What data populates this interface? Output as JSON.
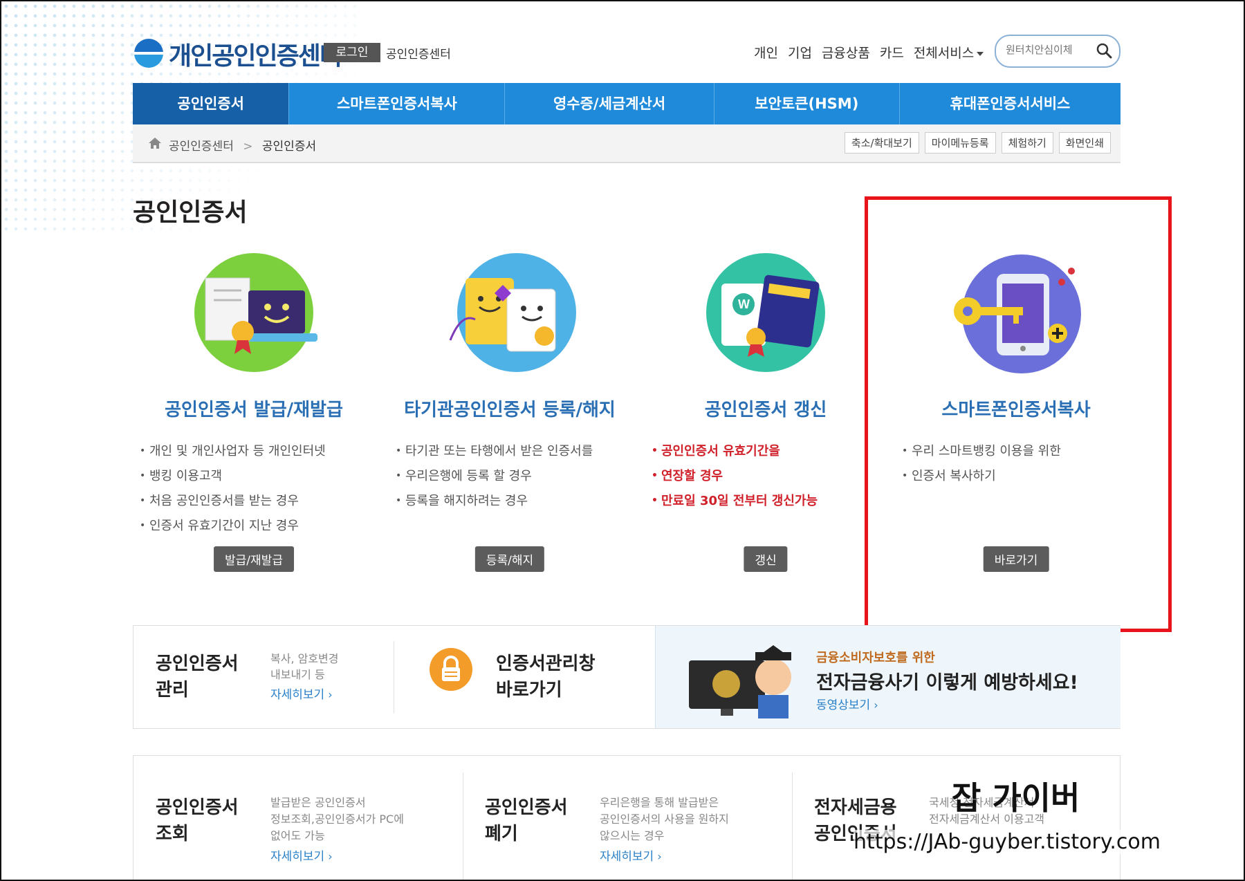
{
  "header": {
    "logo_text": "개인공인인증센터",
    "login_label": "로그인",
    "center_link": "공인인증센터",
    "top_nav": [
      "개인",
      "기업",
      "금융상품",
      "카드",
      "전체서비스"
    ],
    "search_placeholder": "원터치안심이체"
  },
  "main_nav": {
    "tabs": [
      "공인인증서",
      "스마트폰인증서복사",
      "영수증/세금계산서",
      "보안토큰(HSM)",
      "휴대폰인증서서비스"
    ],
    "active_index": 0
  },
  "breadcrumb": {
    "items": [
      "공인인증센터",
      "공인인증서"
    ],
    "separator": ">"
  },
  "tools": [
    "축소/확대보기",
    "마이메뉴등록",
    "체험하기",
    "화면인쇄"
  ],
  "page_title": "공인인증서",
  "cards": [
    {
      "title": "공인인증서 발급/재발급",
      "bullets": [
        "개인 및 개인사업자 등 개인인터넷",
        "뱅킹 이용고객",
        "처음 공인인증서를 받는 경우",
        "인증서 유효기간이 지난 경우"
      ],
      "button": "발급/재발급",
      "icon": "laptop-certificate-icon"
    },
    {
      "title": "타기관공인인증서 등록/해지",
      "bullets": [
        "타기관 또는 타행에서 받은 인증서를",
        "우리은행에 등록 할 경우",
        "등록을 해지하려는 경우"
      ],
      "button": "등록/해지",
      "icon": "certificate-scrolls-icon"
    },
    {
      "title": "공인인증서 갱신",
      "bullets": [
        "공인인증서 유효기간을",
        "연장할 경우",
        "만료일 30일 전부터 갱신가능"
      ],
      "button": "갱신",
      "icon": "calendar-certificate-icon"
    },
    {
      "title": "스마트폰인증서복사",
      "bullets": [
        "우리 스마트뱅킹 이용을 위한",
        "인증서 복사하기"
      ],
      "button": "바로가기",
      "icon": "smartphone-key-icon"
    }
  ],
  "strip1": {
    "mgmt_title_1": "공인인증서",
    "mgmt_title_2": "관리",
    "mgmt_desc_1": "복사, 암호변경",
    "mgmt_desc_2": "내보내기 등",
    "more": "자세히보기",
    "manager_1": "인증서관리창",
    "manager_2": "바로가기",
    "fraud_small": "금융소비자보호를 위한",
    "fraud_big": "전자금융사기 이렇게 예방하세요!",
    "fraud_link": "동영상보기"
  },
  "strip2": [
    {
      "title_1": "공인인증서",
      "title_2": "조회",
      "desc": [
        "발급받은 공인인증서",
        "정보조회,공인인증서가 PC에",
        "없어도 가능"
      ],
      "more": "자세히보기"
    },
    {
      "title_1": "공인인증서",
      "title_2": "폐기",
      "desc": [
        "우리은행을 통해 발급받은",
        "공인인증서의 사용을 원하지",
        "않으시는 경우"
      ],
      "more": "자세히보기"
    },
    {
      "title_1": "전자세금용",
      "title_2": "공인인증서",
      "desc": [
        "국세청 전자세금계산서",
        "전자세금계산서 이용고객"
      ],
      "more": ""
    }
  ],
  "watermark": {
    "line1": "잡 가이버",
    "line2": "https://JAb-guyber.tistory.com"
  },
  "colors": {
    "nav_blue": "#1e8ad9",
    "nav_active": "#1660a8",
    "title_blue": "#2a6fb4",
    "highlight_red": "#e8131b"
  }
}
